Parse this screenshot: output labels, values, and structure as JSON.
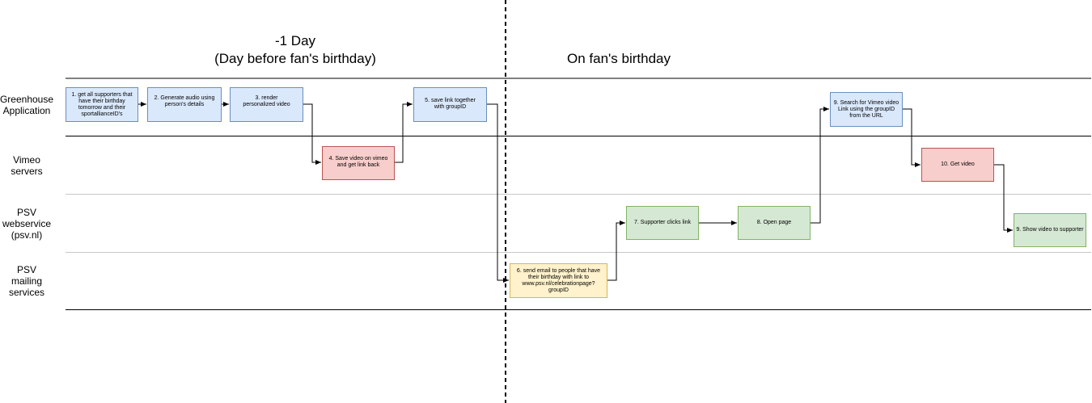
{
  "phases": {
    "before": {
      "line1": "-1 Day",
      "line2": "(Day before fan's birthday)"
    },
    "on": {
      "line1": "On fan's birthday"
    }
  },
  "lanes": [
    {
      "id": "greenhouse",
      "label_lines": [
        "Greenhouse",
        "Application"
      ]
    },
    {
      "id": "vimeo",
      "label_lines": [
        "Vimeo",
        "servers"
      ]
    },
    {
      "id": "psv-web",
      "label_lines": [
        "PSV",
        "webservice",
        "(psv.nl)"
      ]
    },
    {
      "id": "psv-mail",
      "label_lines": [
        "PSV",
        "mailing",
        "services"
      ]
    }
  ],
  "steps": [
    {
      "id": "s1",
      "lane": "greenhouse",
      "color": "blue",
      "text": "1. get all supporters that have their birthday tomorrow and their sportallianceID's"
    },
    {
      "id": "s2",
      "lane": "greenhouse",
      "color": "blue",
      "text": "2. Generate audio using person's details"
    },
    {
      "id": "s3",
      "lane": "greenhouse",
      "color": "blue",
      "text": "3. render personalized video"
    },
    {
      "id": "s4",
      "lane": "vimeo",
      "color": "red",
      "text": "4. Save video on vimeo and get link back"
    },
    {
      "id": "s5",
      "lane": "greenhouse",
      "color": "blue",
      "text": "5. save link together with groupID"
    },
    {
      "id": "s6",
      "lane": "psv-mail",
      "color": "yellow",
      "text": "6. send email to people that have their birthday with link to www.psv.nl/celebrationpage?groupID"
    },
    {
      "id": "s7",
      "lane": "psv-web",
      "color": "green",
      "text": "7. Supporter clicks link"
    },
    {
      "id": "s8",
      "lane": "psv-web",
      "color": "green",
      "text": "8. Open page"
    },
    {
      "id": "s9a",
      "lane": "greenhouse",
      "color": "blue",
      "text": "9. Search for Vimeo video Link using the groupID from the URL"
    },
    {
      "id": "s10",
      "lane": "vimeo",
      "color": "red",
      "text": "10. Get video"
    },
    {
      "id": "s9b",
      "lane": "psv-web",
      "color": "green",
      "text": "9. Show video to supporter"
    }
  ],
  "connections": [
    {
      "from": "s1",
      "to": "s2"
    },
    {
      "from": "s2",
      "to": "s3"
    },
    {
      "from": "s3",
      "to": "s4"
    },
    {
      "from": "s4",
      "to": "s5"
    },
    {
      "from": "s5",
      "to": "s6"
    },
    {
      "from": "s6",
      "to": "s7"
    },
    {
      "from": "s7",
      "to": "s8"
    },
    {
      "from": "s8",
      "to": "s9a"
    },
    {
      "from": "s9a",
      "to": "s10"
    },
    {
      "from": "s10",
      "to": "s9b"
    }
  ],
  "palette": {
    "blue": {
      "fill": "#dae8fc",
      "stroke": "#6c8ebf"
    },
    "red": {
      "fill": "#f8cecc",
      "stroke": "#b85450"
    },
    "green": {
      "fill": "#d5e8d4",
      "stroke": "#82b366"
    },
    "yellow": {
      "fill": "#fff2cc",
      "stroke": "#d6b656"
    },
    "line": "#000000",
    "divider": "#c0c0c0"
  }
}
